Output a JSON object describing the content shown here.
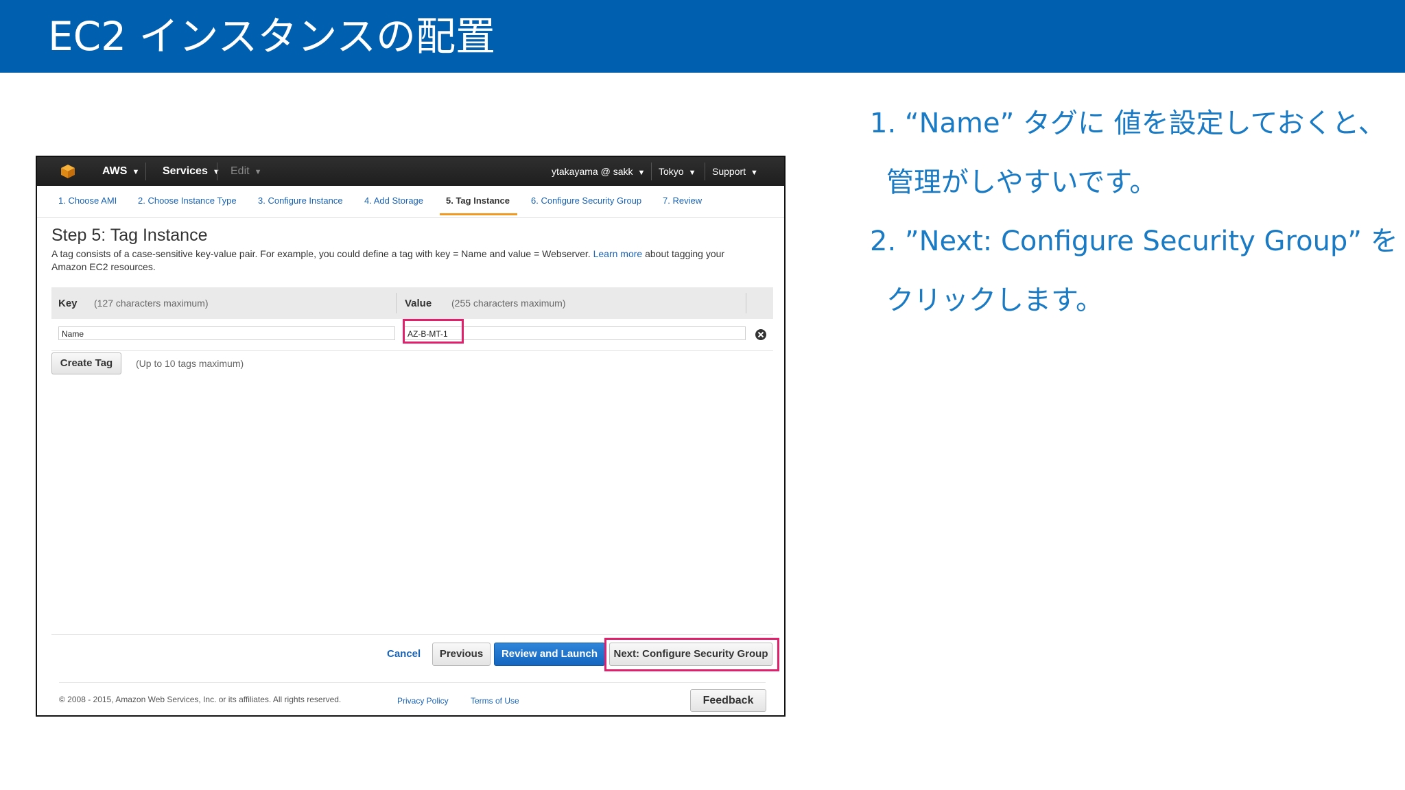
{
  "slide": {
    "title": "EC2 インスタンスの配置",
    "notes": [
      "1. “Name” タグに 値を設定しておくと、",
      "管理がしやすいです。",
      "2. ”Next: Configure Security Group” を",
      "クリックします。"
    ],
    "colors": {
      "header": "#005fae",
      "note_text": "#1a7bc4",
      "highlight": "#e0206b"
    }
  },
  "console": {
    "topbar": {
      "brand": "AWS",
      "services": "Services",
      "edit": "Edit",
      "user": "ytakayama @ sakk",
      "region": "Tokyo",
      "support": "Support"
    },
    "steps": [
      "1. Choose AMI",
      "2. Choose Instance Type",
      "3. Configure Instance",
      "4. Add Storage",
      "5. Tag Instance",
      "6. Configure Security Group",
      "7. Review"
    ],
    "active_step": "5. Tag Instance",
    "page_title": "Step 5: Tag Instance",
    "description_before": "A tag consists of a case-sensitive key-value pair. For example, you could define a tag with key = Name and value = Webserver. ",
    "description_link": "Learn more",
    "description_after": " about tagging your Amazon EC2 resources.",
    "table": {
      "key_header": "Key",
      "key_hint": "(127 characters maximum)",
      "value_header": "Value",
      "value_hint": "(255 characters maximum)",
      "rows": [
        {
          "key": "Name",
          "value": "AZ-B-MT-1"
        }
      ]
    },
    "create_tag": "Create Tag",
    "create_tag_hint": "(Up to 10 tags maximum)",
    "actions": {
      "cancel": "Cancel",
      "previous": "Previous",
      "review_launch": "Review and Launch",
      "next": "Next: Configure Security Group"
    },
    "footer": {
      "copyright": "© 2008 - 2015, Amazon Web Services, Inc. or its affiliates. All rights reserved.",
      "privacy": "Privacy Policy",
      "terms": "Terms of Use",
      "feedback": "Feedback"
    }
  }
}
